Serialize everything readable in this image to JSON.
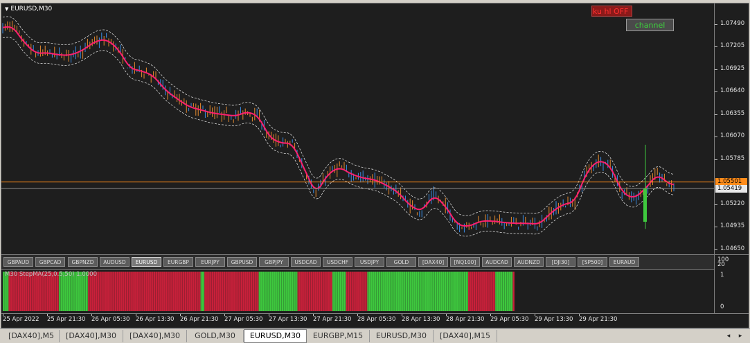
{
  "chart": {
    "title": "EURUSD,M30",
    "toggle_label": "ku hl OFF",
    "channel_label": "channel",
    "price_labels": [
      "1.07490",
      "1.07205",
      "1.06925",
      "1.06640",
      "1.06355",
      "1.06070",
      "1.05785",
      "1.05220",
      "1.04935",
      "1.04650"
    ],
    "price_values": [
      1.0749,
      1.07205,
      1.06925,
      1.0664,
      1.06355,
      1.0607,
      1.05785,
      1.0522,
      1.04935,
      1.0465
    ],
    "price_range": [
      1.0459,
      1.0775
    ],
    "line_price": 1.05501,
    "line_price_label": "1.05501",
    "bid_price": 1.05419,
    "bid_price_label": "1.05419",
    "colors": {
      "bull_candle": "#3a8ee6",
      "bear_candle": "#e68a2e",
      "moving_average": "#ff1f6e",
      "envelope": "#d8d8d8",
      "horizontal_line": "#ff8c1a",
      "bid_line": "#8c8c8c"
    }
  },
  "symbols": [
    {
      "label": "GBPAUD",
      "active": false
    },
    {
      "label": "GBPCAD",
      "active": false
    },
    {
      "label": "GBPNZD",
      "active": false
    },
    {
      "label": "AUDUSD",
      "active": false
    },
    {
      "label": "EURUSD",
      "active": true
    },
    {
      "label": "EURGBP",
      "active": false
    },
    {
      "label": "EURJPY",
      "active": false
    },
    {
      "label": "GBPUSD",
      "active": false
    },
    {
      "label": "GBPJPY",
      "active": false
    },
    {
      "label": "USDCAD",
      "active": false
    },
    {
      "label": "USDCHF",
      "active": false
    },
    {
      "label": "USDJPY",
      "active": false
    },
    {
      "label": "GOLD",
      "active": false
    },
    {
      "label": "[DAX40]",
      "active": false
    },
    {
      "label": "[NQ100]",
      "active": false
    },
    {
      "label": "AUDCAD",
      "active": false
    },
    {
      "label": "AUDNZD",
      "active": false
    },
    {
      "label": "[DJI30]",
      "active": false
    },
    {
      "label": "[SP500]",
      "active": false
    },
    {
      "label": "EURAUD",
      "active": false
    }
  ],
  "indicator": {
    "label": "M30 StepMA(25,0.5,50) 1.0000",
    "scale_labels": [
      "100",
      "20",
      "1",
      "0"
    ],
    "segments": [
      {
        "state": "up",
        "bars": 3
      },
      {
        "state": "down",
        "bars": 26
      },
      {
        "state": "up",
        "bars": 15
      },
      {
        "state": "down",
        "bars": 58
      },
      {
        "state": "up",
        "bars": 2
      },
      {
        "state": "down",
        "bars": 28
      },
      {
        "state": "up",
        "bars": 20
      },
      {
        "state": "down",
        "bars": 18
      },
      {
        "state": "up",
        "bars": 7
      },
      {
        "state": "down",
        "bars": 11
      },
      {
        "state": "up",
        "bars": 52
      },
      {
        "state": "down",
        "bars": 14
      },
      {
        "state": "up",
        "bars": 9
      },
      {
        "state": "down",
        "bars": 1
      }
    ],
    "colors": {
      "up": "#3ec83e",
      "down": "#c8203a"
    }
  },
  "time_labels": [
    "25 Apr 2022",
    "25 Apr 21:30",
    "26 Apr 05:30",
    "26 Apr 13:30",
    "26 Apr 21:30",
    "27 Apr 05:30",
    "27 Apr 13:30",
    "27 Apr 21:30",
    "28 Apr 05:30",
    "28 Apr 13:30",
    "28 Apr 21:30",
    "29 Apr 05:30",
    "29 Apr 13:30",
    "29 Apr 21:30"
  ],
  "tabs": [
    {
      "label": "[DAX40],M5",
      "active": false
    },
    {
      "label": "[DAX40],M30",
      "active": false
    },
    {
      "label": "[DAX40],M30",
      "active": false
    },
    {
      "label": "GOLD,M30",
      "active": false
    },
    {
      "label": "EURUSD,M30",
      "active": true
    },
    {
      "label": "EURGBP,M15",
      "active": false
    },
    {
      "label": "EURUSD,M30",
      "active": false
    },
    {
      "label": "[DAX40],M15",
      "active": false
    }
  ],
  "nav": {
    "prev": "◂",
    "next": "▸"
  },
  "price_path": [
    [
      0,
      1.0744
    ],
    [
      4,
      1.0747
    ],
    [
      9,
      1.0726
    ],
    [
      14,
      1.0712
    ],
    [
      19,
      1.0713
    ],
    [
      24,
      1.071
    ],
    [
      29,
      1.071
    ],
    [
      34,
      1.0716
    ],
    [
      39,
      1.0727
    ],
    [
      44,
      1.073
    ],
    [
      49,
      1.0718
    ],
    [
      54,
      1.0693
    ],
    [
      59,
      1.069
    ],
    [
      64,
      1.0684
    ],
    [
      69,
      1.0666
    ],
    [
      74,
      1.0655
    ],
    [
      79,
      1.0645
    ],
    [
      84,
      1.0641
    ],
    [
      89,
      1.0637
    ],
    [
      94,
      1.0635
    ],
    [
      99,
      1.0633
    ],
    [
      104,
      1.0639
    ],
    [
      109,
      1.0632
    ],
    [
      113,
      1.0607
    ],
    [
      118,
      1.0599
    ],
    [
      123,
      1.0599
    ],
    [
      128,
      1.0567
    ],
    [
      133,
      1.0535
    ],
    [
      138,
      1.056
    ],
    [
      143,
      1.0569
    ],
    [
      148,
      1.056
    ],
    [
      153,
      1.0555
    ],
    [
      158,
      1.0553
    ],
    [
      163,
      1.0546
    ],
    [
      168,
      1.0537
    ],
    [
      173,
      1.052
    ],
    [
      178,
      1.0513
    ],
    [
      183,
      1.0534
    ],
    [
      188,
      1.052
    ],
    [
      193,
      1.0496
    ],
    [
      198,
      1.0494
    ],
    [
      203,
      1.0501
    ],
    [
      208,
      1.0501
    ],
    [
      213,
      1.0499
    ],
    [
      218,
      1.0498
    ],
    [
      223,
      1.0498
    ],
    [
      228,
      1.0497
    ],
    [
      233,
      1.0512
    ],
    [
      238,
      1.0522
    ],
    [
      243,
      1.0525
    ],
    [
      248,
      1.0563
    ],
    [
      253,
      1.0578
    ],
    [
      258,
      1.0571
    ],
    [
      263,
      1.0537
    ],
    [
      268,
      1.0529
    ],
    [
      273,
      1.0542
    ],
    [
      278,
      1.056
    ],
    [
      282,
      1.055
    ],
    [
      285,
      1.0545
    ]
  ]
}
